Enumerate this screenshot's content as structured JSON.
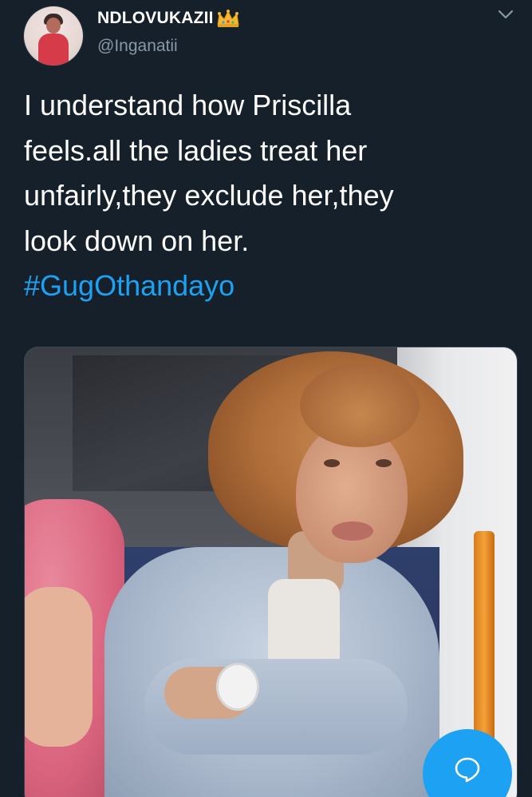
{
  "tweet": {
    "display_name": "NDLOVUKAZII",
    "handle": "@Inganatii",
    "text_lines": [
      "I understand how Priscilla",
      "feels.all the ladies treat her",
      "unfairly,they exclude her,they",
      "look down on her."
    ],
    "hashtag": "#GugOthandayo"
  },
  "icons": {
    "name_badge": "crown-emoji-icon",
    "menu": "chevron-down-icon",
    "fab": "reply-bubble-icon"
  },
  "colors": {
    "background": "#15202b",
    "text": "#ffffff",
    "secondary_text": "#8899a6",
    "accent": "#1da1f2"
  }
}
